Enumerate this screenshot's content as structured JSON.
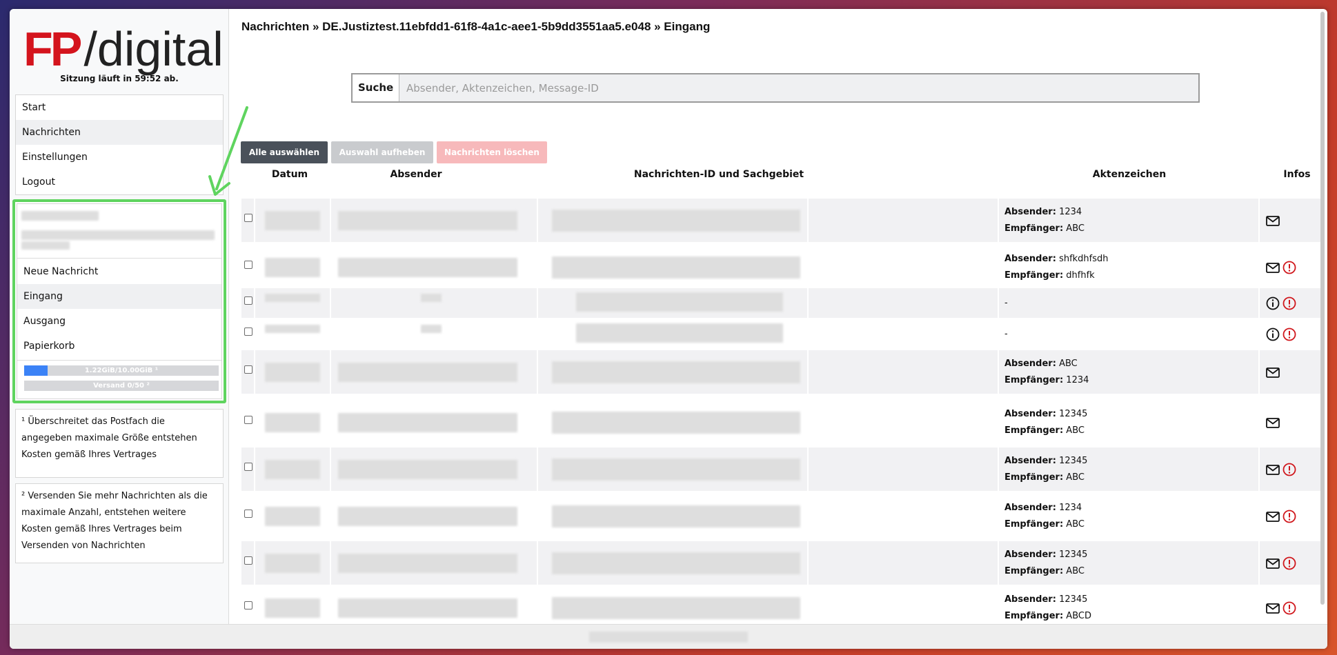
{
  "brand": {
    "fp": "FP",
    "digital": "/digital"
  },
  "session": "Sitzung läuft in 59:52 ab.",
  "nav": [
    "Start",
    "Nachrichten",
    "Einstellungen",
    "Logout"
  ],
  "postbox": {
    "items": [
      "Neue Nachricht",
      "Eingang",
      "Ausgang",
      "Papierkorb"
    ],
    "quota": {
      "label": "1.22GiB/10.00GiB ¹",
      "fraction": 0.122
    },
    "sent": {
      "label": "Versand 0/50 ²",
      "fraction": 0
    }
  },
  "notes": [
    "¹ Überschreitet das Postfach die angegeben maximale Größe entstehen Kosten gemäß Ihres Vertrages",
    "² Versenden Sie mehr Nachrichten als die maximale Anzahl, entstehen weitere Kosten gemäß Ihres Vertrages beim Versenden von Nachrichten"
  ],
  "breadcrumb": "Nachrichten » DE.Justiztest.11ebfdd1-61f8-4a1c-aee1-5b9dd3551aa5.e048 » Eingang",
  "search": {
    "label": "Suche",
    "placeholder": "Absender, Aktenzeichen, Message-ID"
  },
  "buttons": {
    "select_all": "Alle auswählen",
    "deselect": "Auswahl aufheben",
    "delete": "Nachrichten löschen"
  },
  "columns": {
    "date": "Datum",
    "sender": "Absender",
    "msgid": "Nachrichten-ID und Sachgebiet",
    "ref": "Aktenzeichen",
    "info": "Infos"
  },
  "labels": {
    "sender": "Absender:",
    "recipient": "Empfänger:"
  },
  "rows": [
    {
      "sender": "1234",
      "recipient": "ABC",
      "empty": "",
      "icons": [
        "mail-icon"
      ]
    },
    {
      "sender": "shfkdhfsdh",
      "recipient": "dhfhfk",
      "empty": "",
      "icons": [
        "mail-icon",
        "alert-icon"
      ]
    },
    {
      "sender": "",
      "recipient": "",
      "empty": "-",
      "icons": [
        "info-icon",
        "alert-icon"
      ]
    },
    {
      "sender": "",
      "recipient": "",
      "empty": "-",
      "icons": [
        "info-icon",
        "alert-icon"
      ]
    },
    {
      "sender": "ABC",
      "recipient": "1234",
      "empty": "",
      "icons": [
        "mail-icon"
      ]
    },
    {
      "sender": "12345",
      "recipient": "ABC",
      "empty": "",
      "icons": [
        "mail-icon"
      ]
    },
    {
      "sender": "12345",
      "recipient": "ABC",
      "empty": "",
      "icons": [
        "mail-icon",
        "alert-icon"
      ]
    },
    {
      "sender": "1234",
      "recipient": "ABC",
      "empty": "",
      "icons": [
        "mail-icon",
        "alert-icon"
      ]
    },
    {
      "sender": "12345",
      "recipient": "ABC",
      "empty": "",
      "icons": [
        "mail-icon",
        "alert-icon"
      ]
    },
    {
      "sender": "12345",
      "recipient": "ABCD",
      "empty": "",
      "icons": [
        "mail-icon",
        "alert-icon"
      ]
    }
  ],
  "colors": {
    "brand_red": "#d4141d",
    "highlight_green": "#5fd45f",
    "quota_blue": "#3b82f6",
    "alert_red": "#d0161b"
  }
}
